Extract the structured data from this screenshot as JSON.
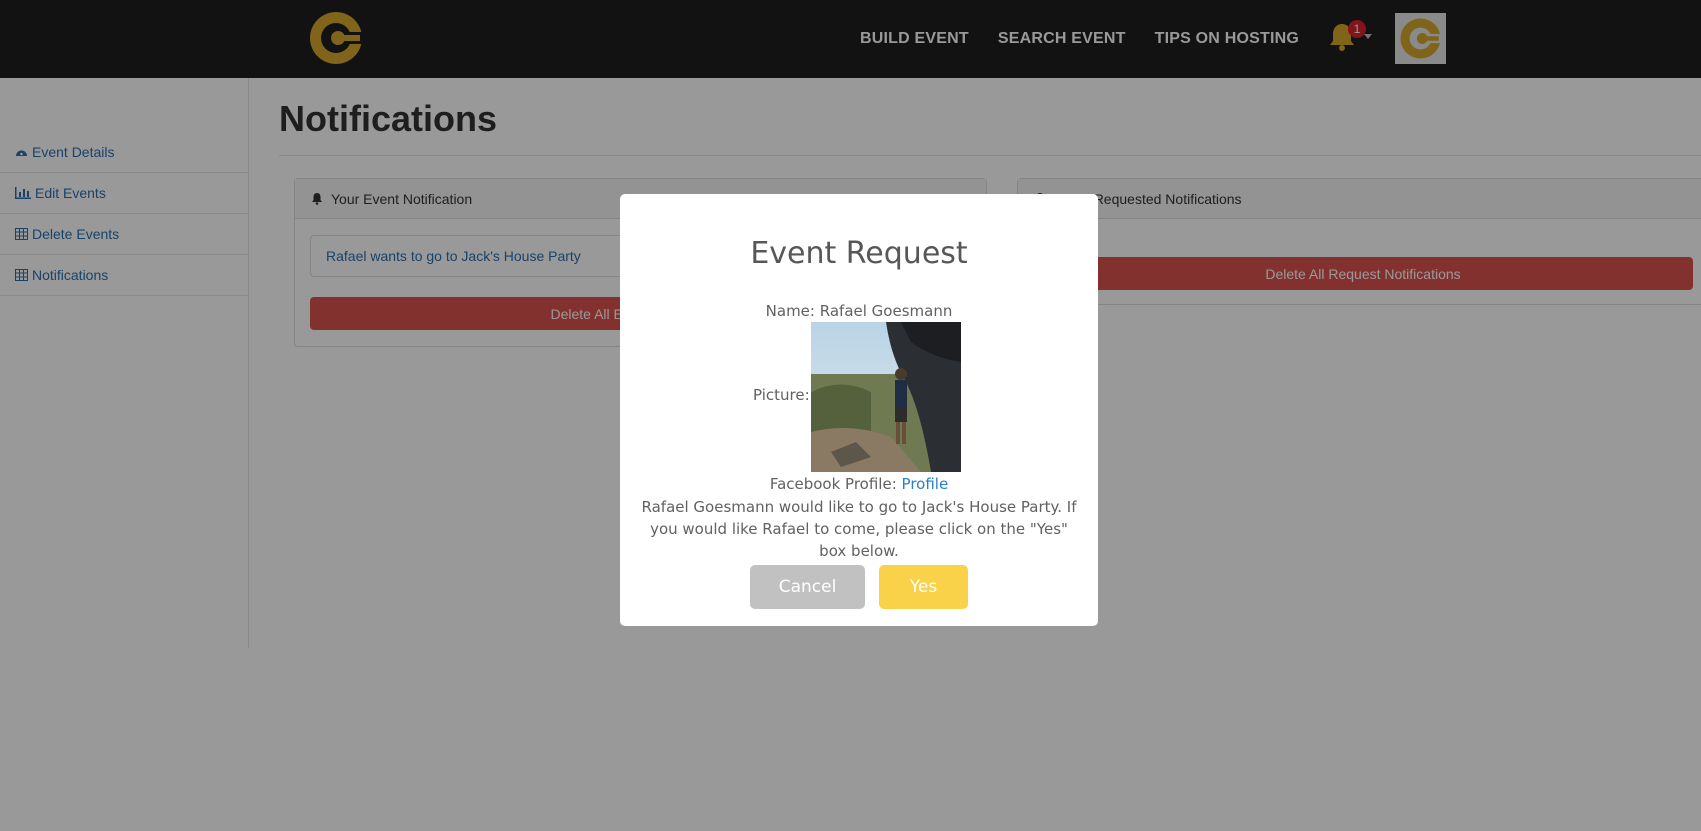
{
  "nav": {
    "links": [
      "BUILD EVENT",
      "SEARCH EVENT",
      "TIPS ON HOSTING"
    ],
    "notification_count": "1"
  },
  "sidebar": {
    "items": [
      {
        "label": "Event Details",
        "icon": "dashboard-icon"
      },
      {
        "label": "Edit Events",
        "icon": "bar-chart-icon"
      },
      {
        "label": "Delete Events",
        "icon": "table-icon"
      },
      {
        "label": "Notifications",
        "icon": "table-icon"
      }
    ]
  },
  "main": {
    "title": "Notifications",
    "left_panel": {
      "heading": "Your Event Notification",
      "item": "Rafael wants to go to Jack's House Party",
      "button": "Delete All Event Notifications"
    },
    "right_panel": {
      "heading": "Event Requested Notifications",
      "button": "Delete All Request Notifications"
    }
  },
  "modal": {
    "title": "Event Request",
    "name_label": "Name:",
    "name": "Rafael Goesmann",
    "picture_label": "Picture:",
    "facebook_label": "Facebook Profile:",
    "facebook_link": "Profile",
    "message": "Rafael Goesmann would like to go to Jack's House Party. If you would like Rafael to come, please click on the \"Yes\" box below.",
    "cancel_label": "Cancel",
    "yes_label": "Yes"
  },
  "colors": {
    "navbar": "#1e1e1e",
    "brand_gold": "#d4a72c",
    "link_blue": "#2a6fb0",
    "danger_red": "#d9534f",
    "yes_yellow": "#f9d24a",
    "cancel_gray": "#c1c1c1"
  }
}
